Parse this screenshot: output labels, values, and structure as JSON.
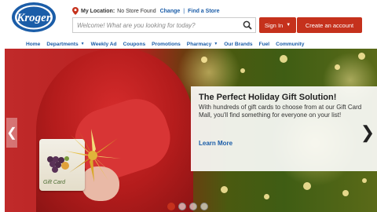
{
  "brand": {
    "name": "Kroger",
    "color": "#1b5da8",
    "accent": "#c5311c"
  },
  "location": {
    "label": "My Location:",
    "status": "No Store Found",
    "change": "Change",
    "separator": "|",
    "find": "Find a Store"
  },
  "search": {
    "placeholder": "Welcome! What are you looking for today?",
    "icon": "search-icon"
  },
  "account": {
    "sign_in": "Sign In",
    "sign_in_caret": "▼",
    "create": "Create an account"
  },
  "nav": {
    "items": [
      {
        "label": "Home",
        "dropdown": false
      },
      {
        "label": "Departments",
        "dropdown": true
      },
      {
        "label": "Weekly Ad",
        "dropdown": false
      },
      {
        "label": "Coupons",
        "dropdown": false
      },
      {
        "label": "Promotions",
        "dropdown": false
      },
      {
        "label": "Pharmacy",
        "dropdown": true
      },
      {
        "label": "Our Brands",
        "dropdown": false
      },
      {
        "label": "Fuel",
        "dropdown": false
      },
      {
        "label": "Community",
        "dropdown": false
      }
    ],
    "caret": "▼"
  },
  "hero": {
    "title": "The Perfect Holiday Gift Solution!",
    "body": "With hundreds of gift cards to choose from at our Gift Card Mall, you'll find something for everyone on your list!",
    "cta": "Learn More",
    "card_label": "Gift Card",
    "prev_glyph": "❮",
    "next_glyph": "❯",
    "slides": 4,
    "active_slide": 1
  }
}
